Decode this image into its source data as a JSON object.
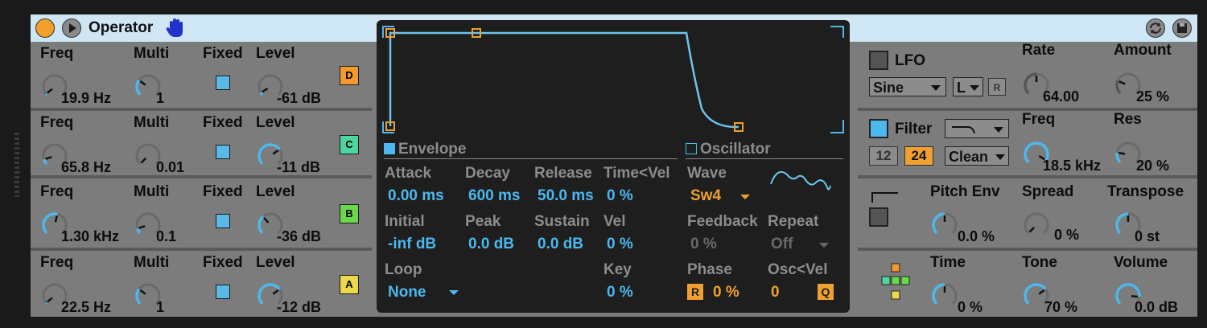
{
  "title": "Operator",
  "colors": {
    "accent": "#4cb8ee",
    "orange": "#f0a030",
    "titlebar": "#cfe6f4"
  },
  "operators": [
    {
      "badge": "D",
      "badge_color": "#f29a2e",
      "freq_label": "Freq",
      "freq": "19.9 Hz",
      "multi_label": "Multi",
      "multi": "1",
      "fixed_label": "Fixed",
      "level_label": "Level",
      "level": "-61 dB",
      "freq_ratio": 0.02,
      "multi_ratio": 0.3,
      "level_ratio": 0.05
    },
    {
      "badge": "C",
      "badge_color": "#4ed6a0",
      "freq_label": "Freq",
      "freq": "65.8 Hz",
      "multi_label": "Multi",
      "multi": "0.01",
      "fixed_label": "Fixed",
      "level_label": "Level",
      "level": "-11 dB",
      "freq_ratio": 0.1,
      "multi_ratio": 0.0,
      "level_ratio": 0.7
    },
    {
      "badge": "B",
      "badge_color": "#6ad84a",
      "freq_label": "Freq",
      "freq": "1.30 kHz",
      "multi_label": "Multi",
      "multi": "0.1",
      "fixed_label": "Fixed",
      "level_label": "Level",
      "level": "-36 dB",
      "freq_ratio": 0.55,
      "multi_ratio": 0.1,
      "level_ratio": 0.35
    },
    {
      "badge": "A",
      "badge_color": "#ecd94a",
      "freq_label": "Freq",
      "freq": "22.5 Hz",
      "multi_label": "Multi",
      "multi": "1",
      "fixed_label": "Fixed",
      "level_label": "Level",
      "level": "-12 dB",
      "freq_ratio": 0.02,
      "multi_ratio": 0.3,
      "level_ratio": 0.7
    }
  ],
  "envelope": {
    "title": "Envelope",
    "attack_label": "Attack",
    "attack": "0.00 ms",
    "decay_label": "Decay",
    "decay": "600 ms",
    "release_label": "Release",
    "release": "50.0 ms",
    "timevel_label": "Time<Vel",
    "timevel": "0 %",
    "initial_label": "Initial",
    "initial": "-inf dB",
    "peak_label": "Peak",
    "peak": "0.0 dB",
    "sustain_label": "Sustain",
    "sustain": "0.0 dB",
    "vel_label": "Vel",
    "vel": "0 %",
    "loop_label": "Loop",
    "loop": "None",
    "key_label": "Key",
    "key": "0 %"
  },
  "oscillator": {
    "title": "Oscillator",
    "wave_label": "Wave",
    "wave": "Sw4",
    "feedback_label": "Feedback",
    "feedback": "0 %",
    "repeat_label": "Repeat",
    "repeat": "Off",
    "phase_label": "Phase",
    "phase": "0 %",
    "phase_btn": "R",
    "oscvel_label": "Osc<Vel",
    "oscvel": "0",
    "q_btn": "Q"
  },
  "lfo": {
    "title": "LFO",
    "wave": "Sine",
    "range": "L",
    "r_btn": "R",
    "rate_label": "Rate",
    "rate": "64.00",
    "rate_ratio": 0.5,
    "amount_label": "Amount",
    "amount": "25 %",
    "amount_ratio": 0.25
  },
  "filter": {
    "title": "Filter",
    "slope_12": "12",
    "slope_24": "24",
    "mode": "Clean",
    "freq_label": "Freq",
    "freq": "18.5 kHz",
    "freq_ratio": 0.95,
    "res_label": "Res",
    "res": "20 %",
    "res_ratio": 0.2
  },
  "pitch": {
    "pitchenv_label": "Pitch Env",
    "pitchenv": "0.0 %",
    "pitchenv_ratio": 0.5,
    "spread_label": "Spread",
    "spread": "0 %",
    "spread_ratio": 0.0,
    "transpose_label": "Transpose",
    "transpose": "0 st",
    "transpose_ratio": 0.5
  },
  "global": {
    "time_label": "Time",
    "time": "0 %",
    "time_ratio": 0.5,
    "tone_label": "Tone",
    "tone": "70 %",
    "tone_ratio": 0.7,
    "volume_label": "Volume",
    "volume": "0.0 dB",
    "volume_ratio": 0.85
  }
}
